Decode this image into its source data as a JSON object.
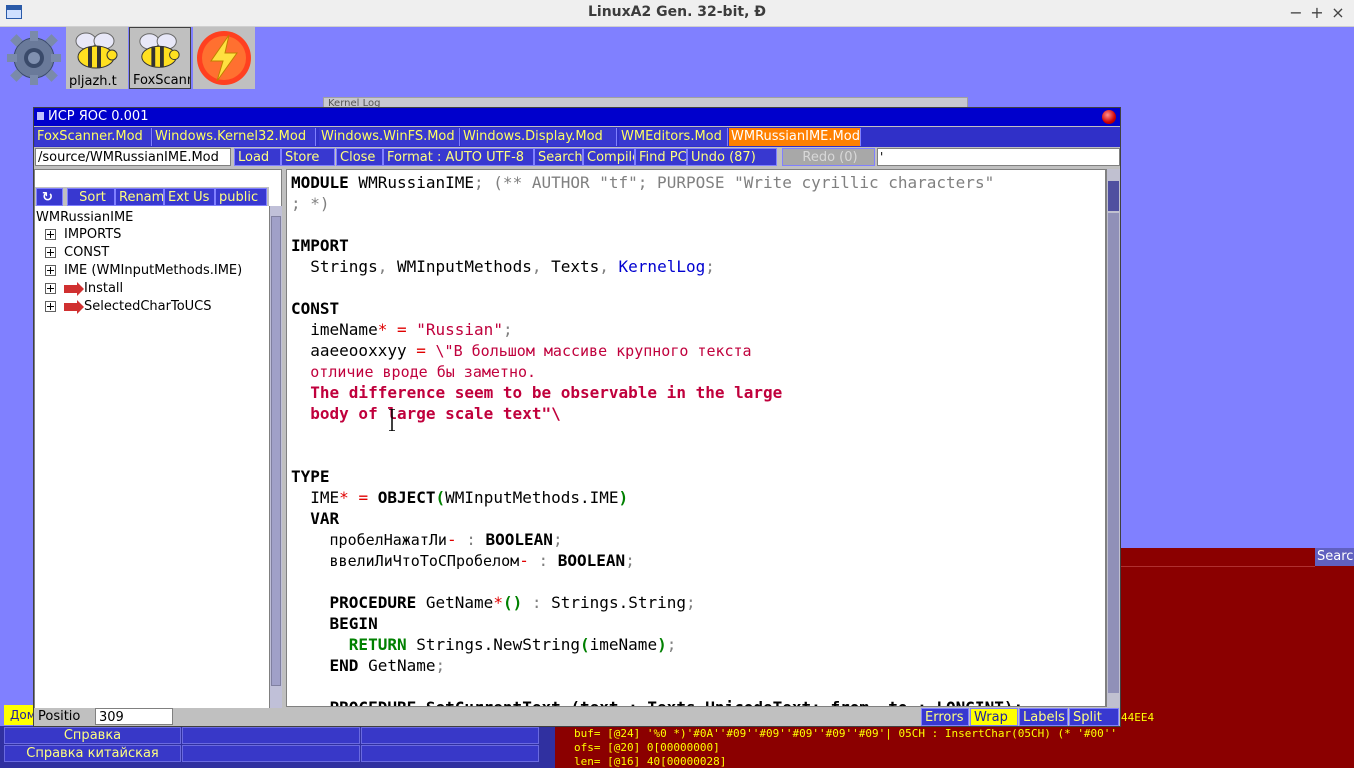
{
  "host": {
    "title": "LinuxA2 Gen. 32-bit, Đ",
    "minimize": "−",
    "maximize": "+",
    "close": "×"
  },
  "desktop_icons": [
    {
      "name": "gear-icon",
      "label": ""
    },
    {
      "name": "bee-icon",
      "label": "pljazh.t"
    },
    {
      "name": "bee-icon",
      "label": "FoxScann"
    },
    {
      "name": "lightning-icon",
      "label": ""
    }
  ],
  "kernel_log_title": "Kernel Log",
  "ide": {
    "title": "ИСР ЯОС 0.001",
    "tabs": [
      "FoxScanner.Mod",
      "Windows.Kernel32.Mod",
      "Windows.WinFS.Mod",
      "Windows.Display.Mod",
      "WMEditors.Mod",
      "WMRussianIME.Mod"
    ],
    "active_tab": 5,
    "path": "/source/WMRussianIME.Mod",
    "toolbar": {
      "load": "Load",
      "store": "Store",
      "close": "Close",
      "format": "Format : AUTO UTF-8",
      "search": "Search",
      "compile": "Compile",
      "find_pc": "Find PC",
      "undo": "Undo (87)",
      "redo": "Redo (0)",
      "input_value": "'"
    },
    "tree": {
      "toolbar": {
        "sort": "Sort",
        "rename": "Rename",
        "ext_us": "Ext Us",
        "public": "public"
      },
      "root": "WMRussianIME",
      "nodes": [
        {
          "label": "IMPORTS",
          "arrow": false
        },
        {
          "label": "CONST",
          "arrow": false
        },
        {
          "label": "IME (WMInputMethods.IME)",
          "arrow": false
        },
        {
          "label": "Install",
          "arrow": true
        },
        {
          "label": "SelectedCharToUCS",
          "arrow": true
        }
      ]
    },
    "status": {
      "position_label": "Positio",
      "position_value": "309",
      "errors": "Errors",
      "wrap": "Wrap",
      "labels": "Labels",
      "split": "Split"
    }
  },
  "code": {
    "l1_kw": "MODULE",
    "l1_name": " WMRussianIME",
    "l1_comment": "; (** AUTHOR \"tf\"; PURPOSE \"Write cyrillic characters\"",
    "l2_comment": "; *)",
    "import_kw": "IMPORT",
    "imports": [
      "Strings",
      "WMInputMethods",
      "Texts",
      "KernelLog"
    ],
    "const_kw": "CONST",
    "imeName_id": "imeName",
    "imeName_val": "\"Russian\"",
    "mix_id": "aaeeooxxyy",
    "mix_str1": "\\\"В большом массиве крупного текста",
    "mix_str2": "отличие вроде бы заметно.",
    "mix_str3": "The difference seem to be observable in the large",
    "mix_str4": "body of large scale text\"\\",
    "type_kw": "TYPE",
    "ime_id": "IME",
    "object_kw": "OBJECT",
    "object_base": "WMInputMethods.IME",
    "var_kw": "VAR",
    "field1": "пробелНажатЛи",
    "field2": "ввелиЛиЧтоТоСПробелом",
    "boolean_kw": "BOOLEAN",
    "procedure_kw": "PROCEDURE",
    "getname": "GetName",
    "ret_type": "Strings.String",
    "begin_kw": "BEGIN",
    "return_kw": "RETURN",
    "newstring": "Strings.NewString",
    "newstring_arg": "imeName",
    "end_kw": "END",
    "partial_line": "PROCEDURE SetCurrentText (text : Texts.UnicodeText; from, to : LONGINT);"
  },
  "log": {
    "search_label": "Searc",
    "lines": [
      "buf= [@24] '%0 *)'#0A''#09''#09''#09''#09''#09'| 05CH : InsertChar(05CH) (* '#00''",
      "ofs= [@20] 0[00000000]",
      "len= [@16] 40[00000028]"
    ],
    "extra": "44EE4"
  },
  "menu": {
    "do_tab": "Дом",
    "items": [
      "Справка",
      "Справка китайская"
    ]
  }
}
